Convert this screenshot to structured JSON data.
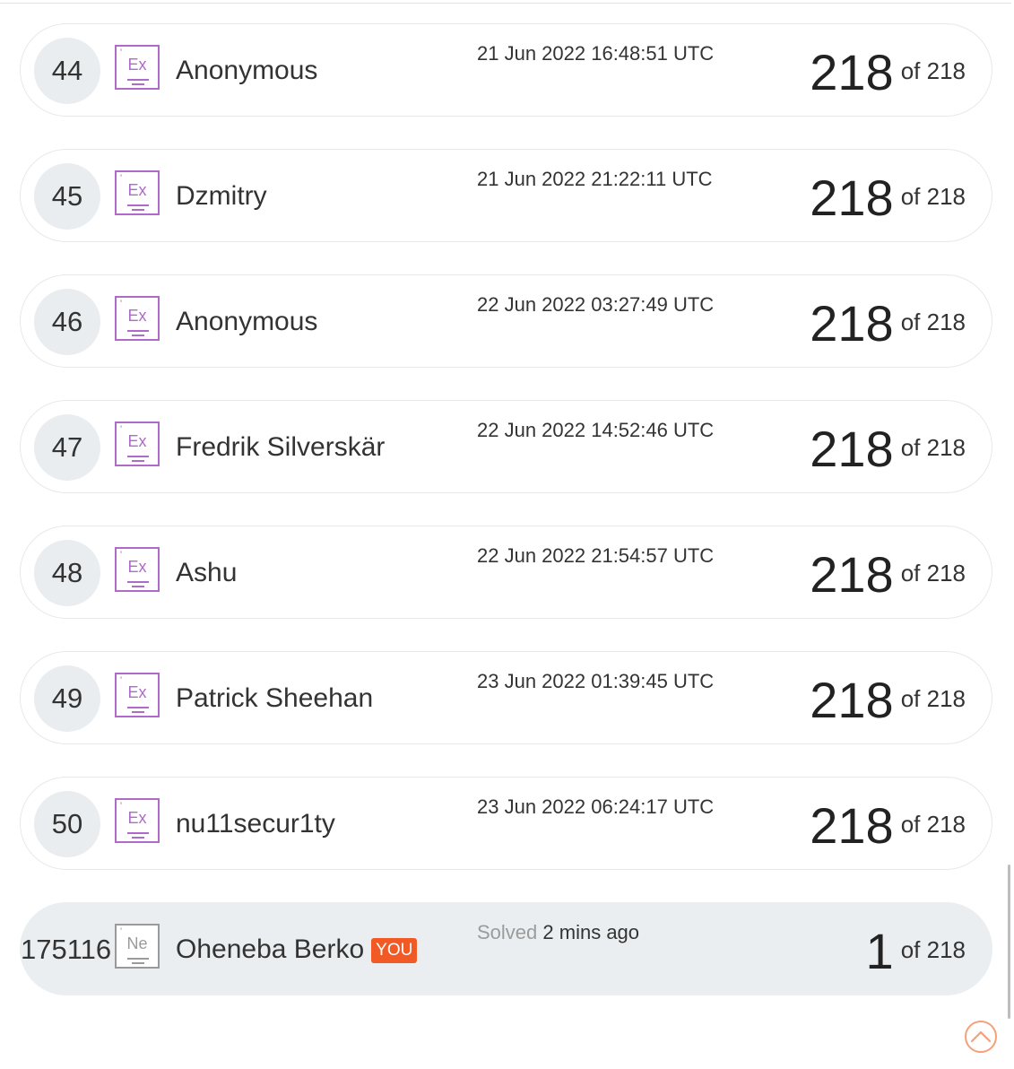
{
  "entries": [
    {
      "rank": "44",
      "badge": {
        "tick": "'",
        "symbol": "Ex"
      },
      "name": "Anonymous",
      "time": "21 Jun 2022 16:48:51 UTC",
      "score": "218",
      "total": "of 218"
    },
    {
      "rank": "45",
      "badge": {
        "tick": "'",
        "symbol": "Ex"
      },
      "name": "Dzmitry",
      "time": "21 Jun 2022 21:22:11 UTC",
      "score": "218",
      "total": "of 218"
    },
    {
      "rank": "46",
      "badge": {
        "tick": "'",
        "symbol": "Ex"
      },
      "name": "Anonymous",
      "time": "22 Jun 2022 03:27:49 UTC",
      "score": "218",
      "total": "of 218"
    },
    {
      "rank": "47",
      "badge": {
        "tick": "'",
        "symbol": "Ex"
      },
      "name": "Fredrik Silverskär",
      "time": "22 Jun 2022 14:52:46 UTC",
      "score": "218",
      "total": "of 218"
    },
    {
      "rank": "48",
      "badge": {
        "tick": "'",
        "symbol": "Ex"
      },
      "name": "Ashu",
      "time": "22 Jun 2022 21:54:57 UTC",
      "score": "218",
      "total": "of 218"
    },
    {
      "rank": "49",
      "badge": {
        "tick": "'",
        "symbol": "Ex"
      },
      "name": "Patrick Sheehan",
      "time": "23 Jun 2022 01:39:45 UTC",
      "score": "218",
      "total": "of 218"
    },
    {
      "rank": "50",
      "badge": {
        "tick": "'",
        "symbol": "Ex"
      },
      "name": "nu11secur1ty",
      "time": "23 Jun 2022 06:24:17 UTC",
      "score": "218",
      "total": "of 218"
    }
  ],
  "self_entry": {
    "rank": "175116",
    "badge": {
      "tick": "'",
      "symbol": "Ne"
    },
    "name": "Oheneba Berko",
    "you_tag": "YOU",
    "time_label": "Solved",
    "time_value": "2 mins ago",
    "score": "1",
    "total": "of 218"
  },
  "colors": {
    "expert_badge": "#b06ac9",
    "newbie_badge": "#9a9a9a",
    "you_tag": "#f15a24",
    "row_border": "#e6e9ea",
    "self_row_bg": "#eaeef0",
    "back_to_top": "#f5a07a"
  },
  "icons": {
    "back_to_top": "chevron-up-circle-icon"
  }
}
